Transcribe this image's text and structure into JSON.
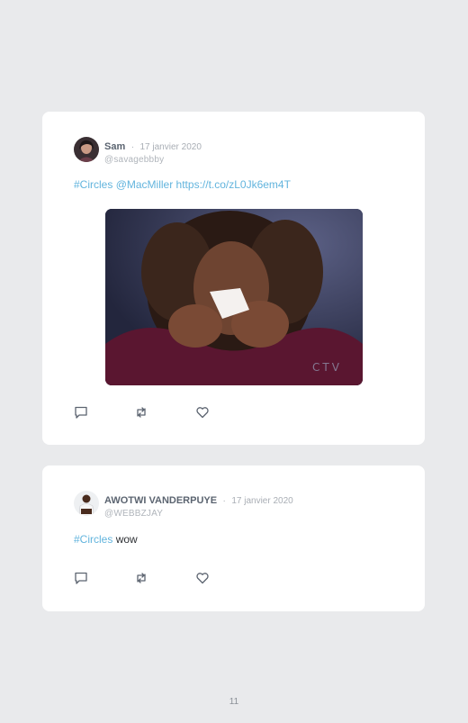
{
  "tweets": [
    {
      "name": "Sam",
      "separator": "·",
      "date": "17 janvier 2020",
      "handle": "@savagebbby",
      "hashtag": "#Circles",
      "mention": "@MacMiller",
      "url": "https://t.co/zL0Jk6em4T",
      "media": {
        "watermark": "CTV"
      },
      "actions": [
        "reply-icon",
        "retweet-icon",
        "like-icon"
      ]
    },
    {
      "name": "AWOTWI VANDERPUYE",
      "separator": "·",
      "date": "17 janvier 2020",
      "handle": "@WEBBZJAY",
      "hashtag": "#Circles",
      "text": "wow",
      "actions": [
        "reply-icon",
        "retweet-icon",
        "like-icon"
      ]
    }
  ],
  "page": {
    "number": "11"
  },
  "colors": {
    "background": "#e9eaec",
    "card": "#ffffff",
    "link": "#62b4dd"
  }
}
